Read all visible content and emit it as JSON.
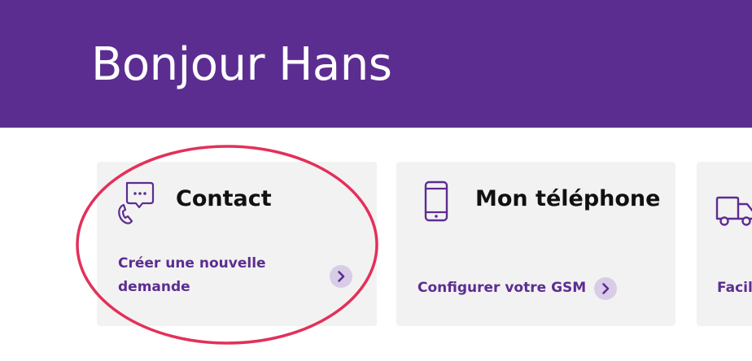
{
  "header": {
    "greeting": "Bonjour Hans"
  },
  "cards": [
    {
      "icon": "chat-phone-icon",
      "title": "Contact",
      "link": "Créer une nouvelle demande",
      "link_line1": "Créer une nouvelle",
      "link_line2": "demande"
    },
    {
      "icon": "mobile-phone-icon",
      "title": "Mon téléphone",
      "link": "Configurer votre GSM"
    },
    {
      "icon": "delivery-truck-icon",
      "title": "",
      "link": "Facil"
    }
  ],
  "colors": {
    "brand": "#5c2d91",
    "card_bg": "#f2f2f2",
    "chevron_bg": "#d8cce6",
    "annotation": "#e3305a"
  }
}
